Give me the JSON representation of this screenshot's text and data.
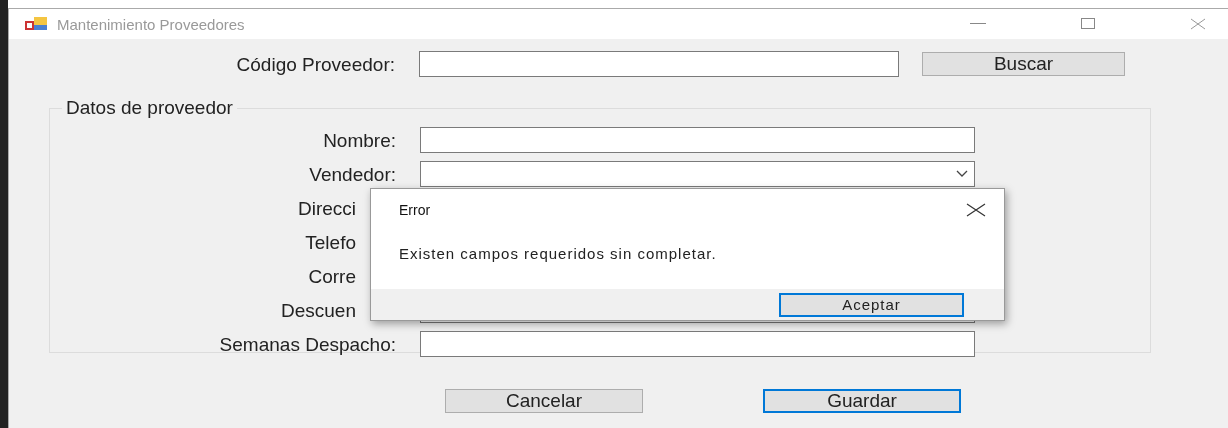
{
  "window": {
    "title": "Mantenimiento Proveedores"
  },
  "code_row": {
    "label": "Código Proveedor:",
    "button": "Buscar"
  },
  "group": {
    "title": "Datos de proveedor",
    "rows": [
      {
        "label": "Nombre:",
        "kind": "text",
        "cut": false
      },
      {
        "label": "Vendedor:",
        "kind": "combo",
        "cut": false
      },
      {
        "label": "Direcci",
        "cut": true
      },
      {
        "label": "Telefo",
        "cut": true
      },
      {
        "label": "Corre",
        "cut": true
      },
      {
        "label": "Descuen",
        "kind": "text",
        "cut": true
      },
      {
        "label": "Semanas Despacho:",
        "kind": "text",
        "cut": false
      }
    ]
  },
  "buttons": [
    {
      "label": "Cancelar",
      "default": false
    },
    {
      "label": "Guardar",
      "default": true
    }
  ],
  "dialog": {
    "title": "Error",
    "message": "Existen campos requeridos sin completar.",
    "button": "Aceptar"
  }
}
